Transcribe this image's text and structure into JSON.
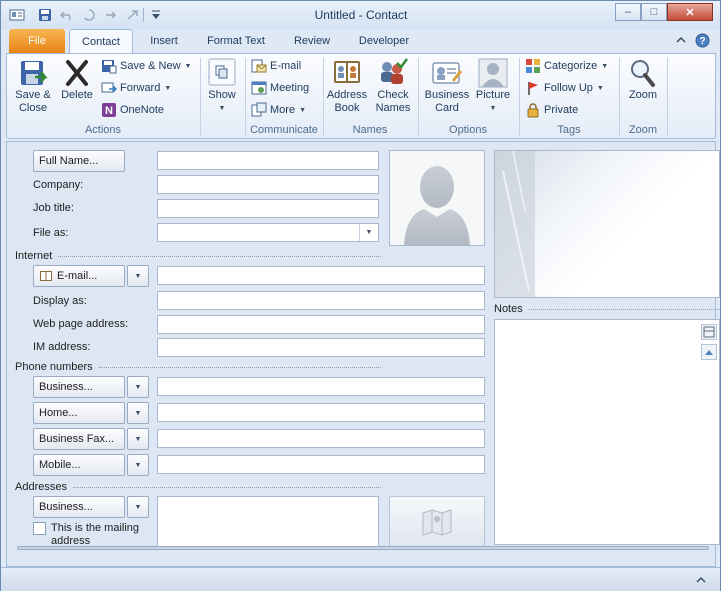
{
  "window": {
    "title": "Untitled  -  Contact"
  },
  "window_controls": {
    "minimize": "–",
    "maximize": "□",
    "close": "✕"
  },
  "tabs": [
    {
      "label": "File"
    },
    {
      "label": "Contact"
    },
    {
      "label": "Insert"
    },
    {
      "label": "Format Text"
    },
    {
      "label": "Review"
    },
    {
      "label": "Developer"
    }
  ],
  "ribbon": {
    "actions": {
      "label": "Actions",
      "save_close_1": "Save &",
      "save_close_2": "Close",
      "delete": "Delete",
      "save_new": "Save & New",
      "forward": "Forward",
      "onenote": "OneNote"
    },
    "show": {
      "label": "Show"
    },
    "communicate": {
      "label": "Communicate",
      "email": "E-mail",
      "meeting": "Meeting",
      "more": "More"
    },
    "names": {
      "label": "Names",
      "address_book_1": "Address",
      "address_book_2": "Book",
      "check_names_1": "Check",
      "check_names_2": "Names"
    },
    "options": {
      "label": "Options",
      "business_card_1": "Business",
      "business_card_2": "Card",
      "picture": "Picture"
    },
    "tags": {
      "label": "Tags",
      "categorize": "Categorize",
      "follow_up": "Follow Up",
      "private": "Private"
    },
    "zoom": {
      "label": "Zoom",
      "zoom": "Zoom"
    }
  },
  "form": {
    "full_name_btn": "Full Name...",
    "company": "Company:",
    "job_title": "Job title:",
    "file_as": "File as:",
    "internet_section": "Internet",
    "email_btn": "E-mail...",
    "display_as": "Display as:",
    "web_page": "Web page address:",
    "im_address": "IM address:",
    "phone_section": "Phone numbers",
    "phone_business": "Business...",
    "phone_home": "Home...",
    "phone_business_fax": "Business Fax...",
    "phone_mobile": "Mobile...",
    "addresses_section": "Addresses",
    "address_business": "Business...",
    "mailing_line1": "This is the mailing",
    "mailing_line2": "address",
    "notes_label": "Notes"
  },
  "colors": {
    "file_tab": "#e98316",
    "accent": "#1e395b"
  }
}
